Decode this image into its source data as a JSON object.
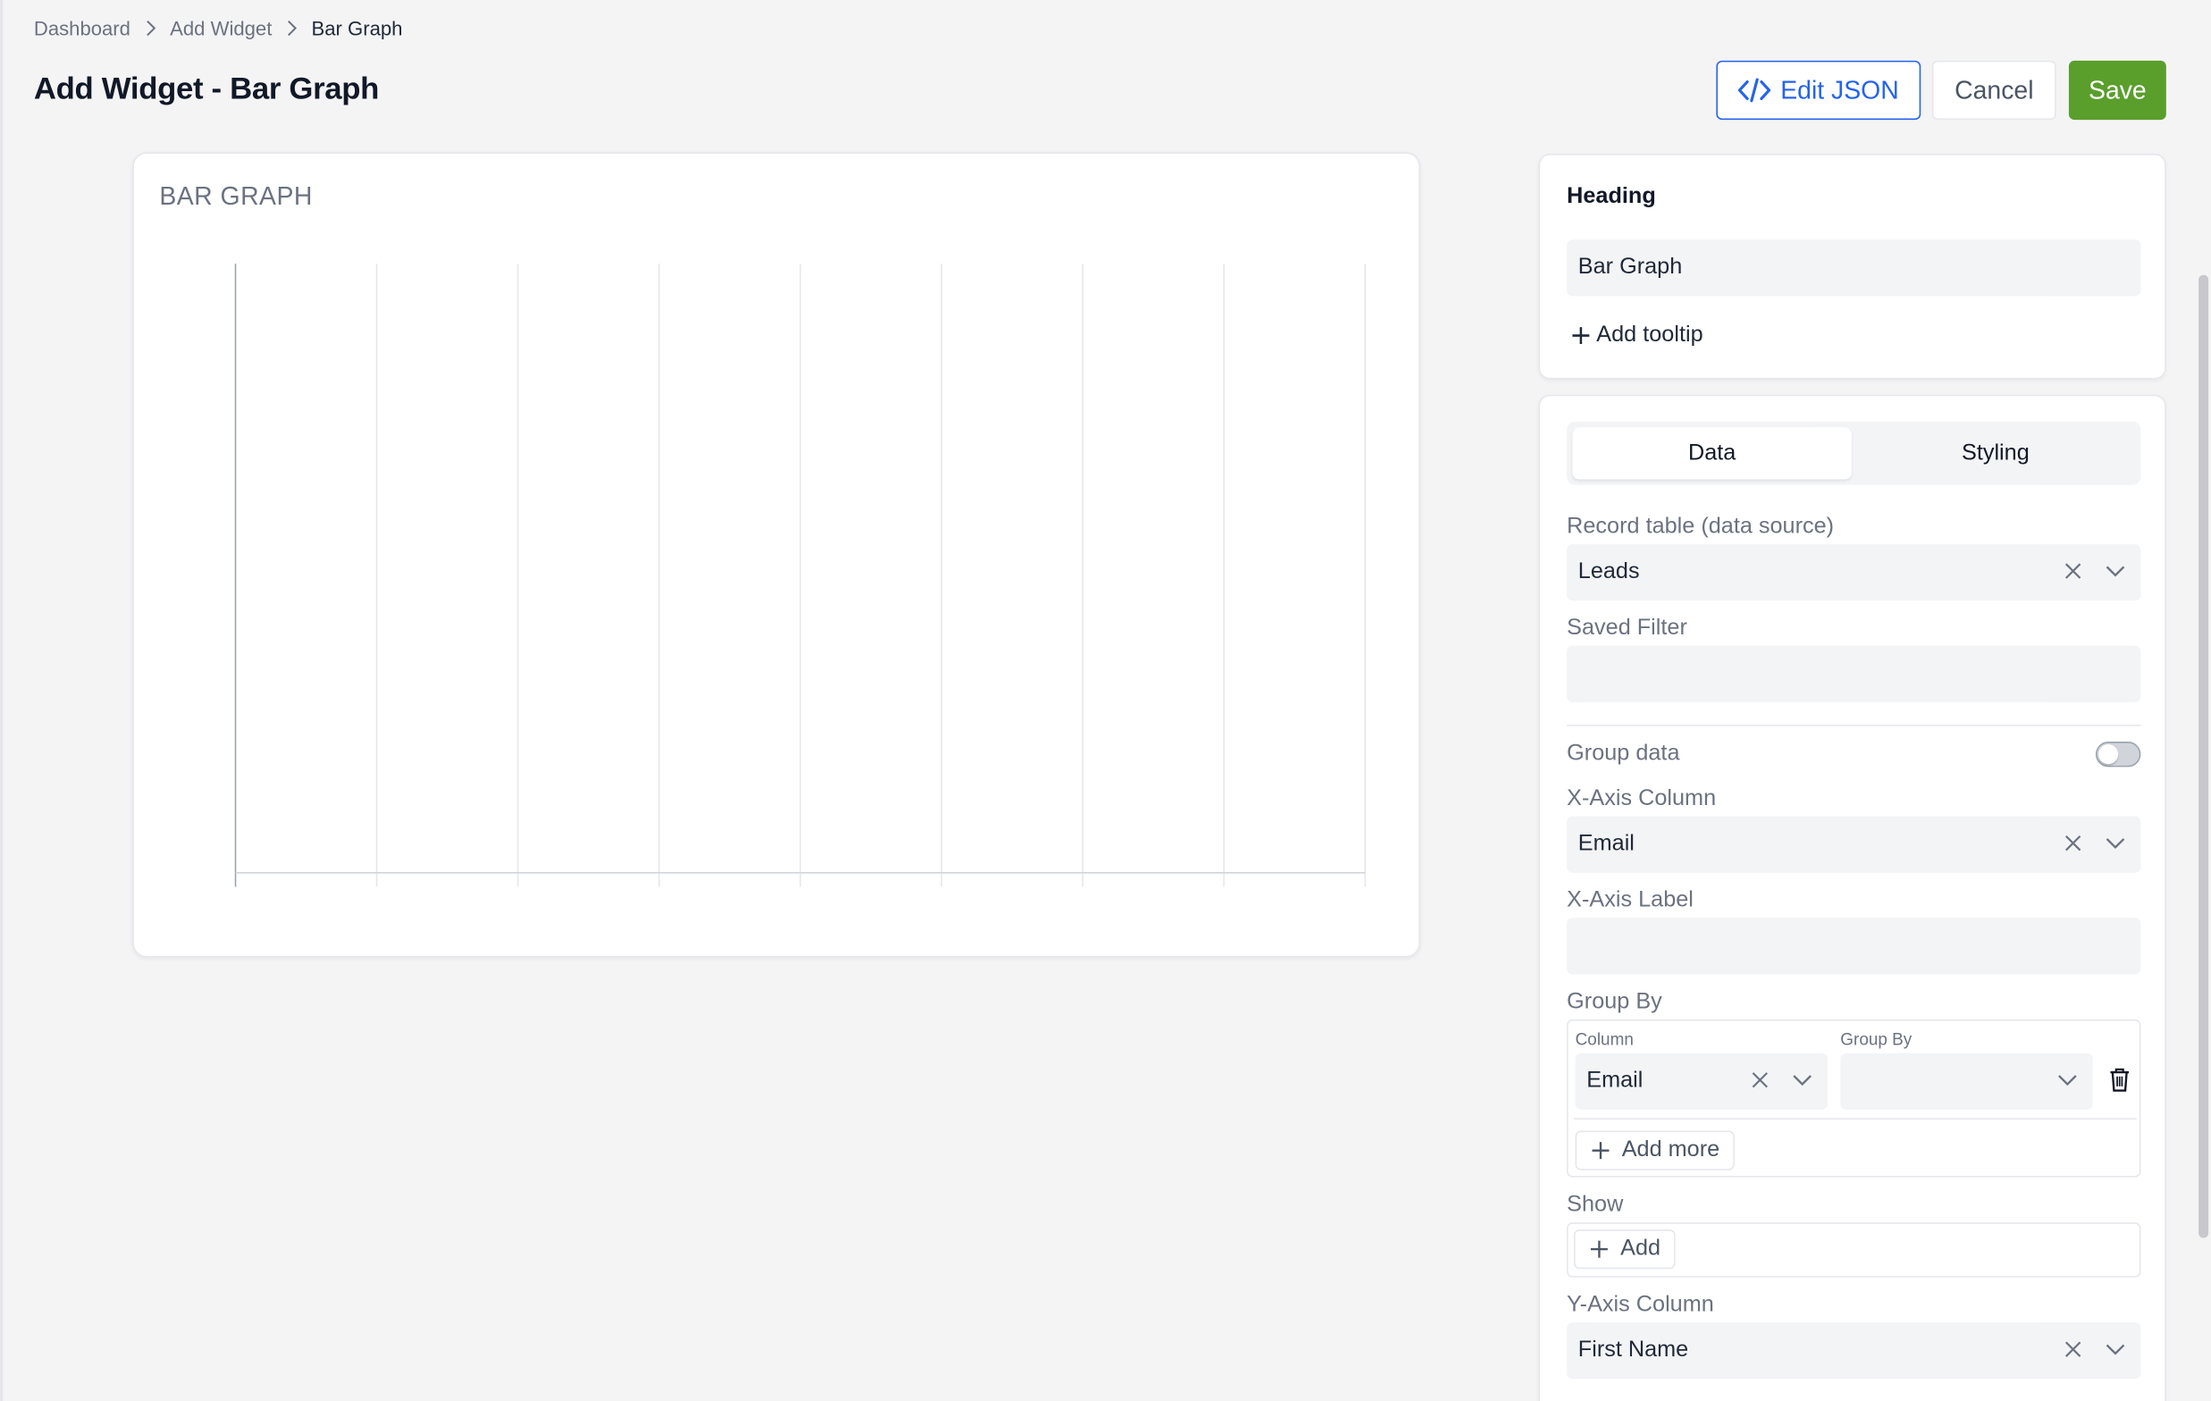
{
  "breadcrumb": {
    "items": [
      "Dashboard",
      "Add Widget",
      "Bar Graph"
    ]
  },
  "page": {
    "title": "Add Widget - Bar Graph"
  },
  "actions": {
    "edit_json": "Edit JSON",
    "cancel": "Cancel",
    "save": "Save"
  },
  "preview": {
    "title": "BAR GRAPH"
  },
  "chart_data": {
    "type": "bar",
    "categories": [],
    "series": [],
    "title": "BAR GRAPH",
    "grid": "vertical",
    "gridline_count": 9
  },
  "heading_panel": {
    "label": "Heading",
    "value": "Bar Graph",
    "add_tooltip": "Add tooltip"
  },
  "tabs": {
    "data": "Data",
    "styling": "Styling"
  },
  "fields": {
    "record_table_label": "Record table (data source)",
    "record_table_value": "Leads",
    "saved_filter_label": "Saved Filter",
    "saved_filter_value": "",
    "group_data_label": "Group data",
    "group_data_on": false,
    "x_axis_column_label": "X-Axis Column",
    "x_axis_column_value": "Email",
    "x_axis_label_label": "X-Axis Label",
    "x_axis_label_value": "",
    "group_by_label": "Group By",
    "group_by_column_header": "Column",
    "group_by_groupby_header": "Group By",
    "group_by_column_value": "Email",
    "group_by_groupby_value": "",
    "add_more": "Add more",
    "show_label": "Show",
    "add": "Add",
    "y_axis_column_label": "Y-Axis Column",
    "y_axis_column_value": "First Name"
  },
  "colors": {
    "primary": "#2563eb",
    "save": "#5a9e2c",
    "background": "#f4f4f5",
    "input": "#f3f4f6"
  }
}
